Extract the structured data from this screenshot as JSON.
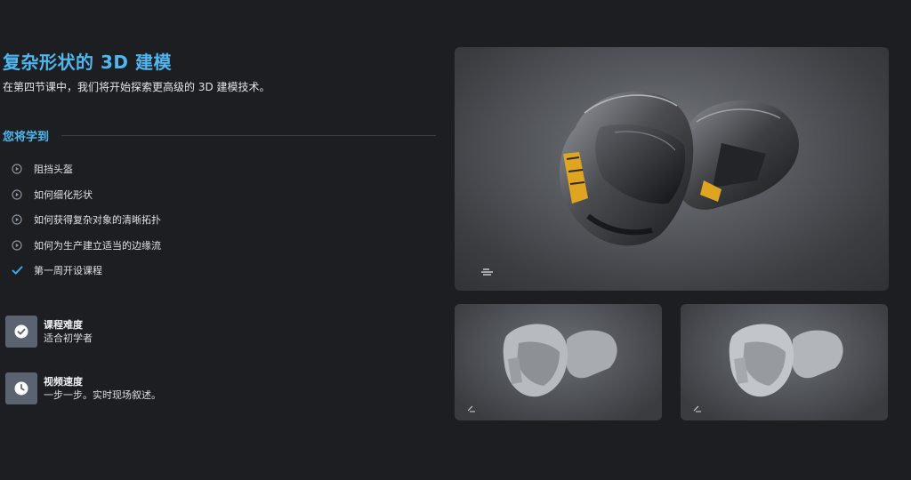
{
  "course": {
    "title": "复杂形状的 3D 建模",
    "subtitle": "在第四节课中，我们将开始探索更高级的 3D 建模技术。"
  },
  "learn": {
    "heading": "您将学到",
    "items": [
      {
        "label": "阻挡头盔",
        "icon": "play-circle-icon"
      },
      {
        "label": "如何细化形状",
        "icon": "play-circle-icon"
      },
      {
        "label": "如何获得复杂对象的清晰拓扑",
        "icon": "play-circle-icon"
      },
      {
        "label": "如何为生产建立适当的边缘流",
        "icon": "play-circle-icon"
      },
      {
        "label": "第一周开设课程",
        "icon": "checkmark-icon"
      }
    ]
  },
  "info": {
    "difficulty": {
      "title": "课程难度",
      "value": "适合初学者",
      "icon": "check-badge-icon"
    },
    "speed": {
      "title": "视频速度",
      "value": "一步一步。实时现场叙述。",
      "icon": "clock-icon"
    }
  },
  "colors": {
    "accent": "#4fb6ee",
    "background": "#1c1e22",
    "badge": "#5b6270",
    "helmet_highlight": "#e0a520"
  }
}
